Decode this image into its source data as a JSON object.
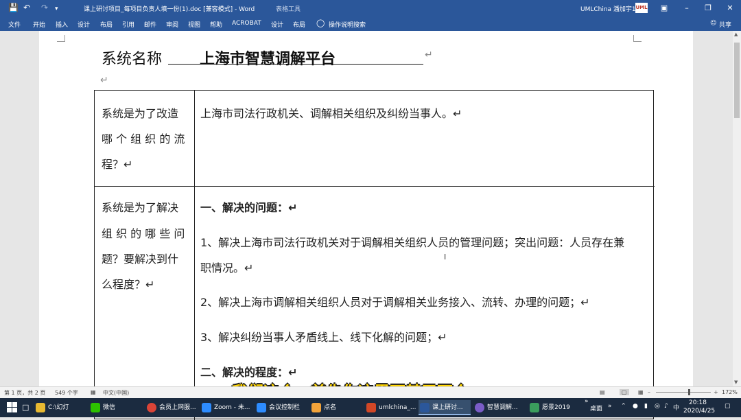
{
  "window": {
    "title": "课上研讨项目_每项目负责人填一份(1).doc [兼容模式] - Word",
    "context_tab": "表格工具",
    "user": "UMLChina 潘加宇1",
    "user_badge": "UML"
  },
  "ribbon": {
    "tabs": [
      "文件",
      "开始",
      "插入",
      "设计",
      "布局",
      "引用",
      "邮件",
      "审阅",
      "视图",
      "帮助",
      "ACROBAT",
      "设计",
      "布局"
    ],
    "tell_me": "操作说明搜索",
    "share": "共享"
  },
  "document": {
    "heading_label": "系统名称",
    "heading_value": "上海市智慧调解平台",
    "paragraph_mark": "↵",
    "rows": [
      {
        "left": [
          "系统是为了改造",
          "哪 个 组 织 的 流",
          "程？↵"
        ],
        "right": [
          "上海市司法行政机关、调解相关组织及纠纷当事人。↵"
        ]
      },
      {
        "left": [
          "系统是为了解决",
          "组 织 的 哪 些 问",
          "题？要解决到什",
          "么程度？↵"
        ],
        "right": [
          "一、解决的问题：↵",
          "1、解决上海市司法行政机关对于调解相关组织人员的管理问题；突出问题：人员存在兼",
          "职情况。↵",
          "2、解决上海市调解相关组织人员对于调解相关业务接入、流转、办理的问题；↵",
          "3、解决纠纷当事人矛盾线上、线下化解的问题；↵",
          "二、解决的程度：↵"
        ]
      }
    ]
  },
  "status": {
    "page": "第 1 页，共 2 页",
    "words": "549 个字",
    "language": "中文(中国)",
    "zoom": "172%"
  },
  "subtitle": "我们这个，首先你这里面基于两个",
  "taskbar": {
    "items": [
      "C:\\幻灯",
      "微信",
      "会员上网服...",
      "Zoom - 未...",
      "会议控制栏",
      "点名",
      "umlchina_...",
      "课上研讨...",
      "智慧调解...",
      "愿景2019"
    ],
    "desktop": "桌面",
    "ime": "中",
    "time": "20:18",
    "date": "2020/4/25"
  },
  "colors": {
    "word_blue": "#2b579a",
    "taskbar": "#1b2b40",
    "subtitle": "#ffd400"
  }
}
